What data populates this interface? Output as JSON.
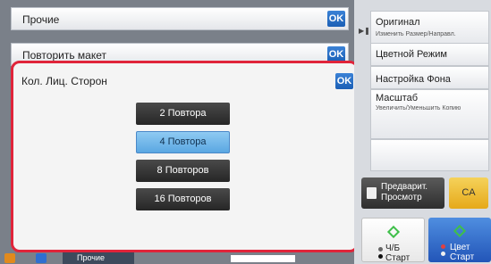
{
  "panel": {
    "other": {
      "label": "Прочие",
      "ok": "OK"
    },
    "repeat_layout": {
      "label": "Повторить макет",
      "ok": "OK"
    },
    "dialog": {
      "title": "Кол. Лиц. Сторон",
      "ok": "OK",
      "options": [
        "2 Повтора",
        "4 Повтора",
        "8 Повторов",
        "16 Повторов"
      ],
      "selected_index": 1
    }
  },
  "sidebar": {
    "original": {
      "title": "Оригинал",
      "sub": "Изменить Размер/Направл."
    },
    "color_mode": {
      "title": "Цветной Режим"
    },
    "background": {
      "title": "Настройка Фона"
    },
    "zoom": {
      "title": "Масштаб",
      "sub": "Увеличить/Уменьшить Копию"
    }
  },
  "actions": {
    "preview": "Предварит. Просмотр",
    "ca": "CA",
    "bw_start": "Ч/Б Старт",
    "color_start": "Цвет Старт"
  },
  "taskbar": {
    "tab_label": "Прочие"
  },
  "colors": {
    "accent_blue": "#1b5fb5",
    "highlight_red": "#e0243a",
    "selected": "#5aa7e2",
    "start_green": "#3fbf4a",
    "ca_yellow": "#e6a91a"
  }
}
